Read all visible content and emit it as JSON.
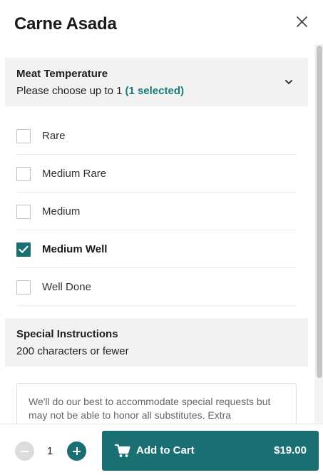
{
  "modal": {
    "title": "Carne Asada"
  },
  "meat_temperature": {
    "title": "Meat Temperature",
    "subtitle": "Please choose up to 1",
    "selected_count": "(1 selected)",
    "options": [
      {
        "label": "Rare",
        "checked": false
      },
      {
        "label": "Medium Rare",
        "checked": false
      },
      {
        "label": "Medium",
        "checked": false
      },
      {
        "label": "Medium Well",
        "checked": true
      },
      {
        "label": "Well Done",
        "checked": false
      }
    ]
  },
  "special_instructions": {
    "title": "Special Instructions",
    "subtitle": "200 characters or fewer",
    "placeholder": "We'll do our best to accommodate special requests but may not be able to honor all substitutes. Extra"
  },
  "footer": {
    "quantity": "1",
    "add_label": "Add to Cart",
    "price": "$19.00"
  },
  "colors": {
    "accent": "#1a6f73",
    "selected_text": "#1a7a7a",
    "section_bg": "#f2f2f2"
  },
  "icons": {
    "close": "close-icon",
    "chevron": "chevron-down-icon",
    "cart": "cart-icon",
    "check": "checkmark-icon"
  }
}
